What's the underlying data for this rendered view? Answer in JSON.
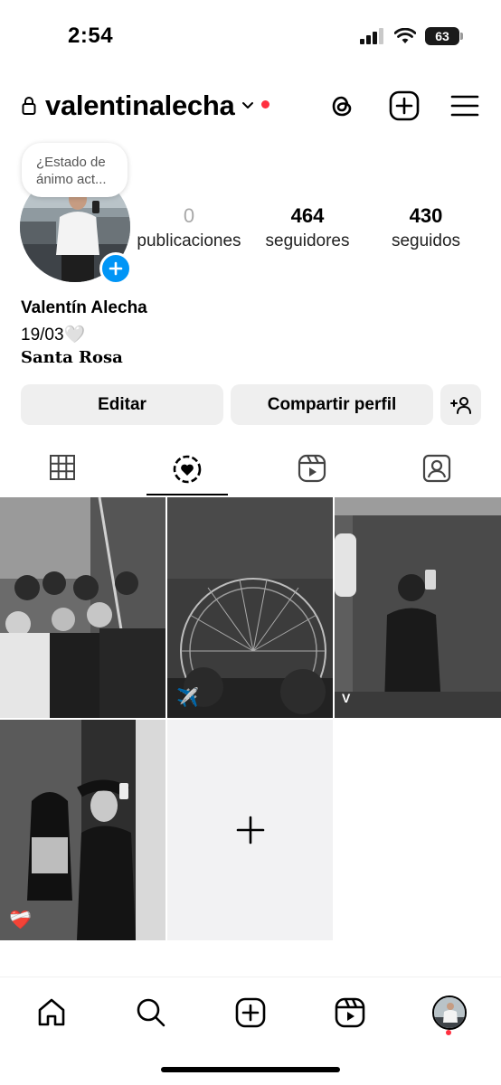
{
  "status_bar": {
    "time": "2:54",
    "battery": "63"
  },
  "header": {
    "username": "valentinalecha",
    "icons": [
      "lock-icon",
      "chevron-down-icon",
      "threads-icon",
      "create-post-icon",
      "menu-icon"
    ]
  },
  "profile": {
    "note_bubble": "¿Estado de ánimo act...",
    "stats": [
      {
        "value": "0",
        "label": "publicaciones"
      },
      {
        "value": "464",
        "label": "seguidores"
      },
      {
        "value": "430",
        "label": "seguidos"
      }
    ],
    "name": "Valentín Alecha",
    "bio_line": "19/03🤍",
    "location": "Santa Rosa"
  },
  "buttons": {
    "edit": "Editar",
    "share": "Compartir perfil"
  },
  "tabs": [
    "grid-icon",
    "highlights-icon",
    "reels-icon",
    "tagged-icon"
  ],
  "grid_badges": {
    "ferris": "✈️",
    "mirror": "V",
    "couple": "❤️‍🩹"
  },
  "bottom_nav": [
    "home-icon",
    "search-icon",
    "create-icon",
    "reels-icon",
    "profile-avatar"
  ],
  "colors": {
    "accent": "#0095f6",
    "notification": "#ff3040",
    "button_bg": "#efefef"
  }
}
